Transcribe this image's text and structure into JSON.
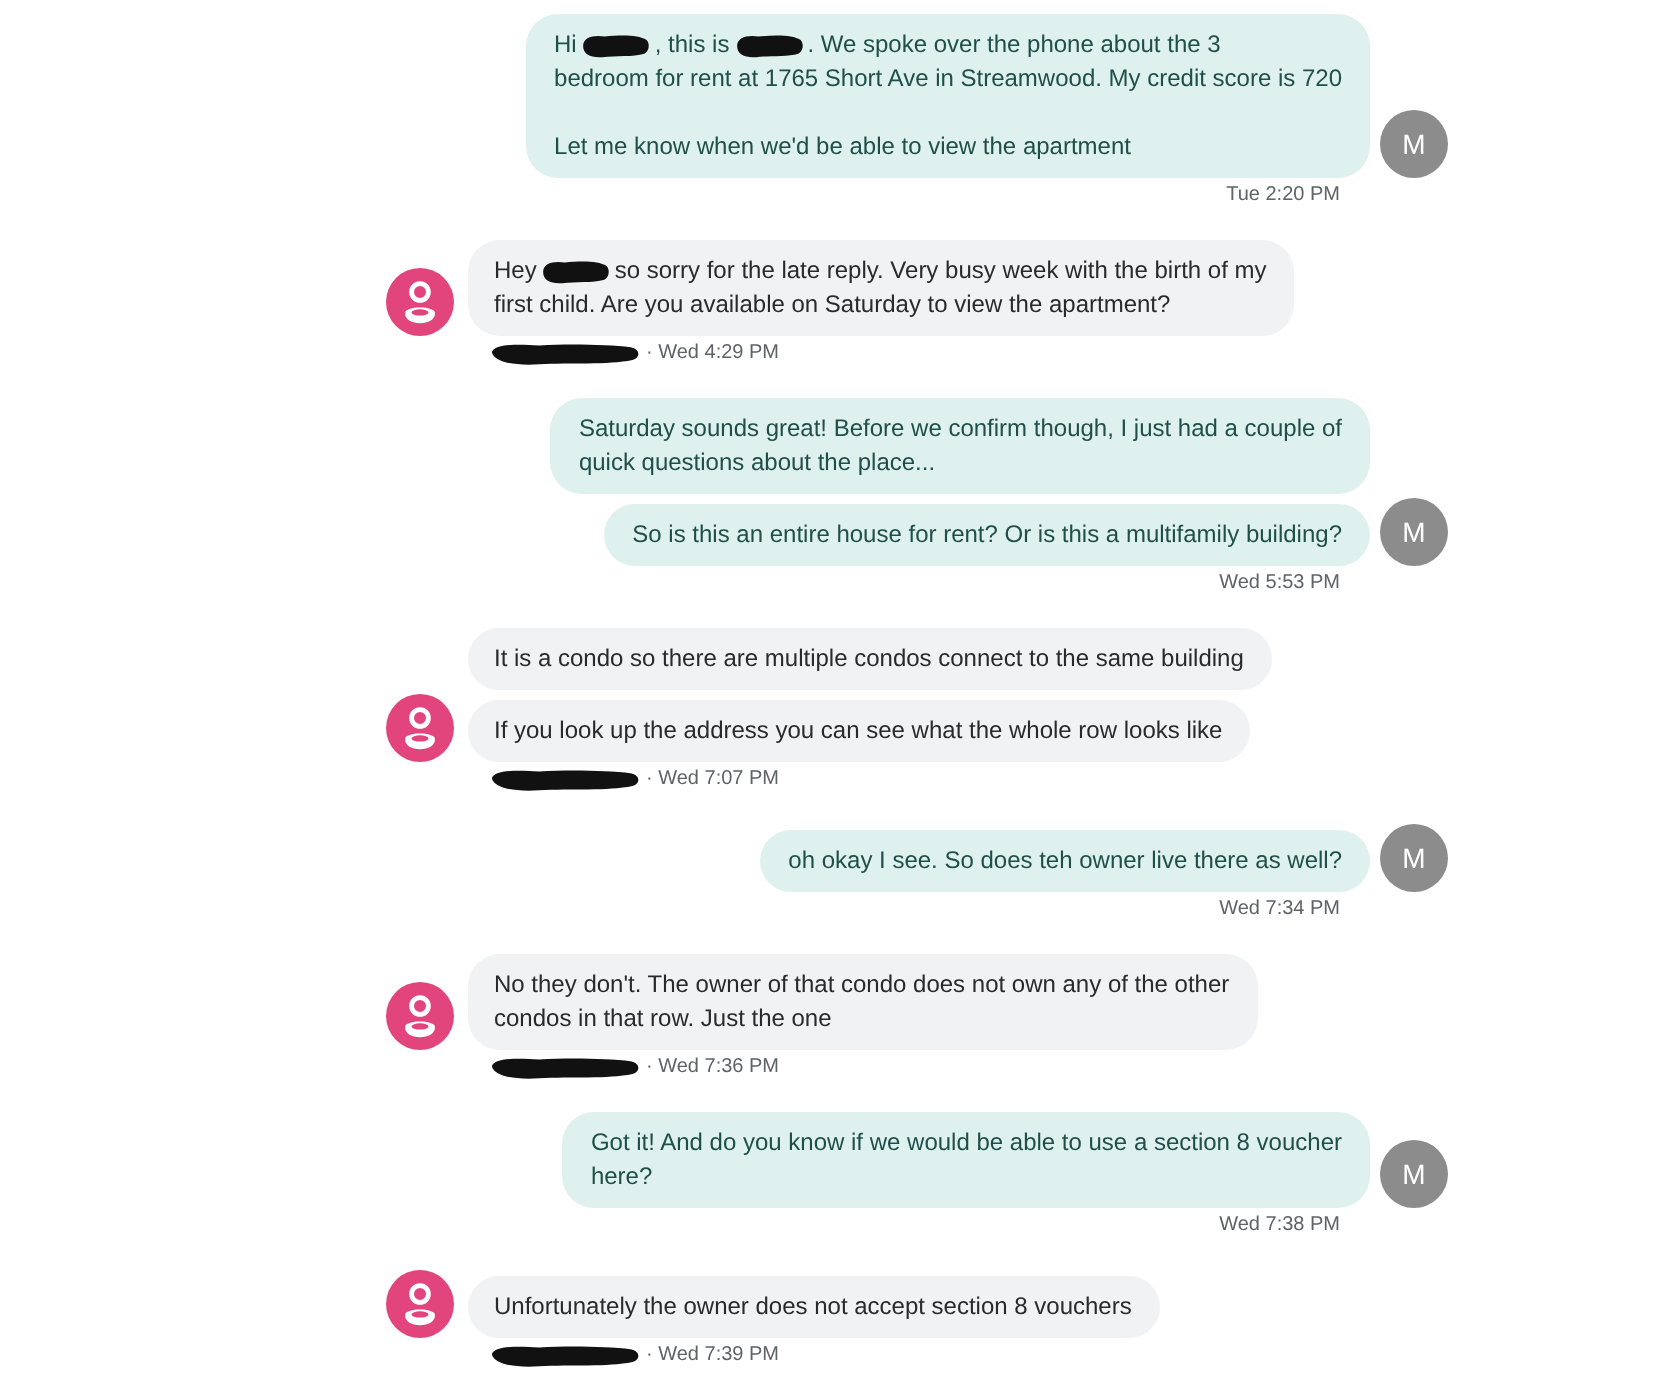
{
  "conversation": [
    {
      "kind": "outgoing",
      "bubbles": [
        {
          "parts": [
            {
              "kind": "text",
              "text": "Hi"
            },
            {
              "kind": "redaction"
            },
            {
              "kind": "text",
              "text": ", this is"
            },
            {
              "kind": "redaction"
            },
            {
              "kind": "text",
              "text": ". We spoke over the phone about the 3"
            },
            {
              "kind": "break"
            },
            {
              "kind": "text",
              "text": "bedroom for rent at 1765 Short Ave in Streamwood. My credit score is 720\n\nLet me know when we'd be able to view the apartment"
            }
          ]
        }
      ],
      "avatar": "M",
      "time": "Tue 2:20 PM"
    },
    {
      "kind": "incoming",
      "bubbles": [
        {
          "parts": [
            {
              "kind": "text",
              "text": "Hey"
            },
            {
              "kind": "redaction"
            },
            {
              "kind": "text",
              "text": "so sorry for the late reply. Very busy week with the birth of my"
            },
            {
              "kind": "break"
            },
            {
              "kind": "text",
              "text": "first child. Are you available on Saturday to view the apartment?"
            }
          ]
        }
      ],
      "sender": {
        "kind": "redaction"
      },
      "time": "· Wed 4:29 PM"
    },
    {
      "kind": "outgoing",
      "bubbles": [
        {
          "parts": [
            {
              "kind": "text",
              "text": "Saturday sounds great! Before we confirm though, I just had a couple of\nquick questions about the place..."
            }
          ]
        },
        {
          "parts": [
            {
              "kind": "text",
              "text": "So is this an entire house for rent? Or is this a multifamily building?"
            }
          ]
        }
      ],
      "avatar": "M",
      "time": "Wed 5:53 PM"
    },
    {
      "kind": "incoming",
      "bubbles": [
        {
          "parts": [
            {
              "kind": "text",
              "text": "It is a condo so there are multiple condos connect to the same building"
            }
          ]
        },
        {
          "parts": [
            {
              "kind": "text",
              "text": "If you look up the address you can see what the whole row looks like"
            }
          ]
        }
      ],
      "sender": {
        "kind": "redaction"
      },
      "time": "· Wed 7:07 PM"
    },
    {
      "kind": "outgoing",
      "bubbles": [
        {
          "parts": [
            {
              "kind": "text",
              "text": "oh okay I see. So does teh owner live there as well?"
            }
          ]
        }
      ],
      "avatar": "M",
      "time": "Wed 7:34 PM"
    },
    {
      "kind": "incoming",
      "bubbles": [
        {
          "parts": [
            {
              "kind": "text",
              "text": "No they don't. The owner of that condo does not own any of the other\ncondos in that row. Just the one"
            }
          ]
        }
      ],
      "sender": {
        "kind": "redaction"
      },
      "time": "· Wed 7:36 PM"
    },
    {
      "kind": "outgoing",
      "bubbles": [
        {
          "parts": [
            {
              "kind": "text",
              "text": "Got it! And do you know if we would be able to use a section 8 voucher\nhere?"
            }
          ]
        }
      ],
      "avatar": "M",
      "time": "Wed 7:38 PM"
    },
    {
      "kind": "incoming",
      "bubbles": [
        {
          "parts": [
            {
              "kind": "text",
              "text": "Unfortunately the owner does not accept section 8 vouchers"
            }
          ]
        }
      ],
      "sender": {
        "kind": "redaction"
      },
      "time": "· Wed 7:39 PM"
    }
  ]
}
